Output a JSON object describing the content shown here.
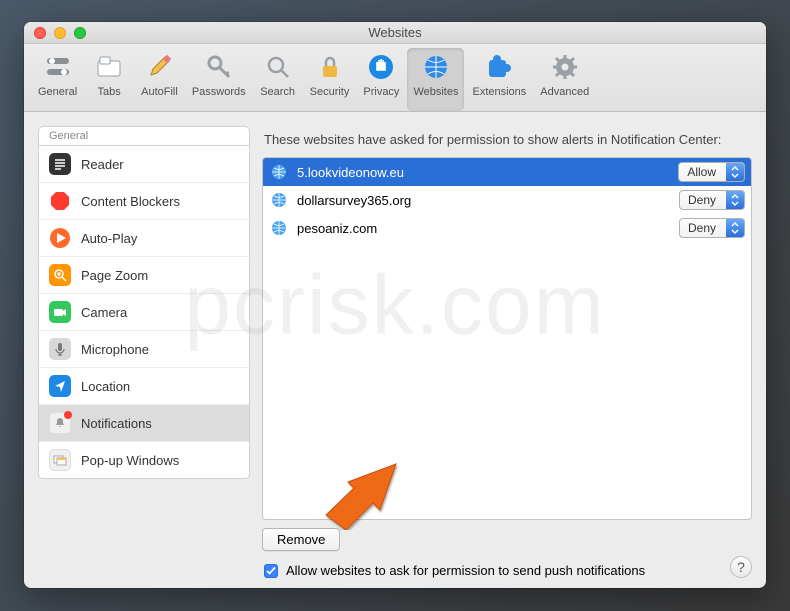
{
  "window": {
    "title": "Websites"
  },
  "toolbar": {
    "items": [
      {
        "label": "General"
      },
      {
        "label": "Tabs"
      },
      {
        "label": "AutoFill"
      },
      {
        "label": "Passwords"
      },
      {
        "label": "Search"
      },
      {
        "label": "Security"
      },
      {
        "label": "Privacy"
      },
      {
        "label": "Websites"
      },
      {
        "label": "Extensions"
      },
      {
        "label": "Advanced"
      }
    ]
  },
  "sidebar": {
    "header": "General",
    "items": [
      {
        "label": "Reader"
      },
      {
        "label": "Content Blockers"
      },
      {
        "label": "Auto-Play"
      },
      {
        "label": "Page Zoom"
      },
      {
        "label": "Camera"
      },
      {
        "label": "Microphone"
      },
      {
        "label": "Location"
      },
      {
        "label": "Notifications"
      },
      {
        "label": "Pop-up Windows"
      }
    ]
  },
  "main": {
    "description": "These websites have asked for permission to show alerts in Notification Center:",
    "rows": [
      {
        "site": "5.lookvideonow.eu",
        "perm": "Allow"
      },
      {
        "site": "dollarsurvey365.org",
        "perm": "Deny"
      },
      {
        "site": "pesoaniz.com",
        "perm": "Deny"
      }
    ],
    "remove_label": "Remove",
    "checkbox_label": "Allow websites to ask for permission to send push notifications",
    "help_label": "?"
  },
  "watermark": "pcrisk.com"
}
